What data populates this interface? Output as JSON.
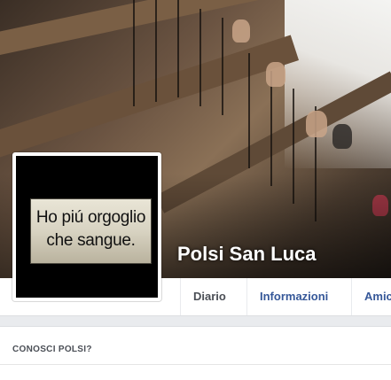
{
  "page": {
    "name": "Polsi San Luca",
    "profile_picture_text": {
      "line1": "Ho piú orgoglio",
      "line2": "che sangue."
    }
  },
  "tabs": [
    {
      "label": "Diario"
    },
    {
      "label": "Informazioni"
    },
    {
      "label": "Amic"
    }
  ],
  "sidebar_panel": {
    "title": "CONOSCI POLSI?"
  },
  "colors": {
    "link": "#365899",
    "page_bg": "#e9ebee",
    "tab_text": "#4b4f56"
  }
}
